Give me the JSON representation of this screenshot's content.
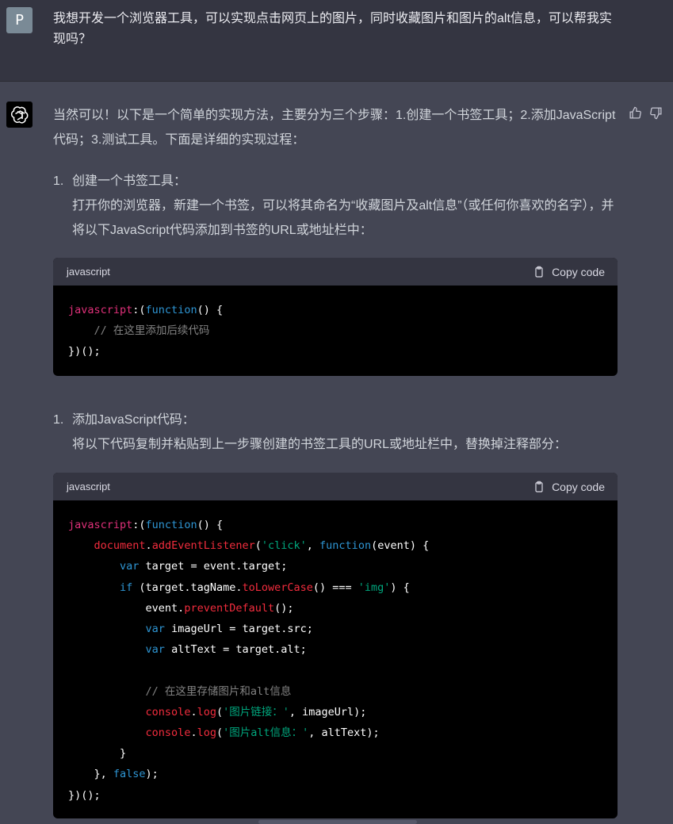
{
  "user_message": {
    "avatar_letter": "P",
    "text": "我想开发一个浏览器工具，可以实现点击网页上的图片，同时收藏图片和图片的alt信息，可以帮我实现吗？"
  },
  "assistant": {
    "avatar_icon": "openai-logo-icon",
    "intro": "当然可以！以下是一个简单的实现方法，主要分为三个步骤：1.创建一个书签工具；2.添加JavaScript代码；3.测试工具。下面是详细的实现过程：",
    "steps": [
      {
        "number": "1.",
        "title": "创建一个书签工具：",
        "description": "打开你的浏览器，新建一个书签，可以将其命名为“收藏图片及alt信息”（或任何你喜欢的名字），并将以下JavaScript代码添加到书签的URL或地址栏中："
      },
      {
        "number": "1.",
        "title": "添加JavaScript代码：",
        "description": "将以下代码复制并粘贴到上一步骤创建的书签工具的URL或地址栏中，替换掉注释部分："
      }
    ],
    "code_blocks": [
      {
        "language": "javascript",
        "copy_label": "Copy code",
        "lines": [
          [
            [
              "kw",
              "javascript"
            ],
            [
              "pl",
              ":("
            ],
            [
              "fn",
              "function"
            ],
            [
              "pl",
              "() {"
            ]
          ],
          [
            [
              "pl",
              "    "
            ],
            [
              "com",
              "// 在这里添加后续代码"
            ]
          ],
          [
            [
              "pl",
              "})();"
            ]
          ]
        ]
      },
      {
        "language": "javascript",
        "copy_label": "Copy code",
        "lines": [
          [
            [
              "kw",
              "javascript"
            ],
            [
              "pl",
              ":("
            ],
            [
              "fn",
              "function"
            ],
            [
              "pl",
              "() {"
            ]
          ],
          [
            [
              "pl",
              "    "
            ],
            [
              "red",
              "document"
            ],
            [
              "pl",
              "."
            ],
            [
              "red",
              "addEventListener"
            ],
            [
              "pl",
              "("
            ],
            [
              "str",
              "'click'"
            ],
            [
              "pl",
              ", "
            ],
            [
              "fn",
              "function"
            ],
            [
              "pl",
              "(event) {"
            ]
          ],
          [
            [
              "pl",
              "        "
            ],
            [
              "fn",
              "var"
            ],
            [
              "pl",
              " target = event.target;"
            ]
          ],
          [
            [
              "pl",
              "        "
            ],
            [
              "fn",
              "if"
            ],
            [
              "pl",
              " (target.tagName."
            ],
            [
              "red",
              "toLowerCase"
            ],
            [
              "pl",
              "() === "
            ],
            [
              "str",
              "'img'"
            ],
            [
              "pl",
              ") {"
            ]
          ],
          [
            [
              "pl",
              "            event."
            ],
            [
              "red",
              "preventDefault"
            ],
            [
              "pl",
              "();"
            ]
          ],
          [
            [
              "pl",
              "            "
            ],
            [
              "fn",
              "var"
            ],
            [
              "pl",
              " imageUrl = target.src;"
            ]
          ],
          [
            [
              "pl",
              "            "
            ],
            [
              "fn",
              "var"
            ],
            [
              "pl",
              " altText = target.alt;"
            ]
          ],
          [
            [
              "pl",
              ""
            ]
          ],
          [
            [
              "pl",
              "            "
            ],
            [
              "com",
              "// 在这里存储图片和alt信息"
            ]
          ],
          [
            [
              "pl",
              "            "
            ],
            [
              "red",
              "console"
            ],
            [
              "pl",
              "."
            ],
            [
              "red",
              "log"
            ],
            [
              "pl",
              "("
            ],
            [
              "str",
              "'图片链接：'"
            ],
            [
              "pl",
              ", imageUrl);"
            ]
          ],
          [
            [
              "pl",
              "            "
            ],
            [
              "red",
              "console"
            ],
            [
              "pl",
              "."
            ],
            [
              "red",
              "log"
            ],
            [
              "pl",
              "("
            ],
            [
              "str",
              "'图片alt信息：'"
            ],
            [
              "pl",
              ", altText);"
            ]
          ],
          [
            [
              "pl",
              "        }"
            ]
          ],
          [
            [
              "pl",
              "    }, "
            ],
            [
              "fn",
              "false"
            ],
            [
              "pl",
              ");"
            ]
          ],
          [
            [
              "pl",
              "})();"
            ]
          ]
        ]
      }
    ],
    "feedback": {
      "thumbs_up_icon": "thumbs-up-icon",
      "thumbs_down_icon": "thumbs-down-icon"
    }
  },
  "colors": {
    "user_bg": "#343541",
    "assistant_bg": "#444654",
    "code_bg": "#000000",
    "code_header_bg": "#343541",
    "keyword": "#df3079",
    "function": "#2e95d3",
    "string": "#00a67d"
  }
}
